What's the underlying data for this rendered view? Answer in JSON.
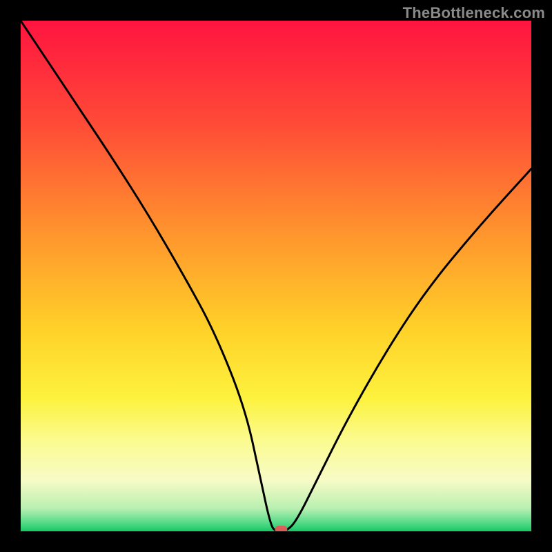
{
  "watermark": "TheBottleneck.com",
  "chart_data": {
    "type": "line",
    "title": "",
    "xlabel": "",
    "ylabel": "",
    "xlim": [
      0,
      100
    ],
    "ylim": [
      0,
      100
    ],
    "optimum_x": 50,
    "series": [
      {
        "name": "bottleneck-curve",
        "x": [
          0,
          12,
          18,
          25,
          32,
          38,
          44,
          47,
          49,
          50,
          52,
          54,
          58,
          64,
          72,
          80,
          90,
          100
        ],
        "values": [
          100,
          82,
          73,
          62,
          50,
          39,
          24,
          10,
          1,
          0,
          0,
          2,
          10,
          22,
          36,
          48,
          60,
          71
        ]
      }
    ],
    "marker": {
      "x": 51,
      "y": 0,
      "color": "#d9605a"
    },
    "gradient_stops": [
      {
        "offset": 0.0,
        "color": "#ff1440"
      },
      {
        "offset": 0.2,
        "color": "#ff4a37"
      },
      {
        "offset": 0.4,
        "color": "#ff8f2e"
      },
      {
        "offset": 0.6,
        "color": "#ffd028"
      },
      {
        "offset": 0.74,
        "color": "#fdf23e"
      },
      {
        "offset": 0.82,
        "color": "#fbfb8e"
      },
      {
        "offset": 0.9,
        "color": "#f7fbc6"
      },
      {
        "offset": 0.955,
        "color": "#b9f0b1"
      },
      {
        "offset": 0.985,
        "color": "#4fd985"
      },
      {
        "offset": 1.0,
        "color": "#17c765"
      }
    ]
  }
}
